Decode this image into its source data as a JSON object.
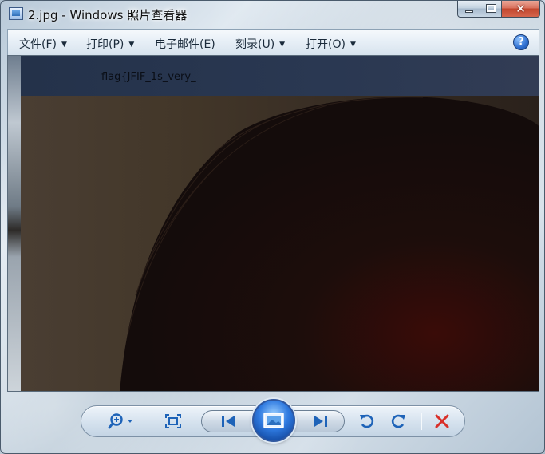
{
  "window": {
    "title": "2.jpg - Windows 照片查看器"
  },
  "menu": {
    "items": [
      {
        "label": "文件(F)",
        "has_arrow": true
      },
      {
        "label": "打印(P)",
        "has_arrow": true
      },
      {
        "label": "电子邮件(E)",
        "has_arrow": false
      },
      {
        "label": "刻录(U)",
        "has_arrow": true
      },
      {
        "label": "打开(O)",
        "has_arrow": true
      }
    ],
    "help_glyph": "?"
  },
  "image": {
    "overlay_text": "flag{JFIF_1s_very_"
  },
  "controls": {
    "icons": [
      "zoom-icon",
      "actual-size-icon",
      "previous-icon",
      "slideshow-icon",
      "next-icon",
      "rotate-left-icon",
      "rotate-right-icon",
      "delete-icon"
    ],
    "accent_color": "#1e63b8",
    "delete_color": "#d9302a"
  }
}
